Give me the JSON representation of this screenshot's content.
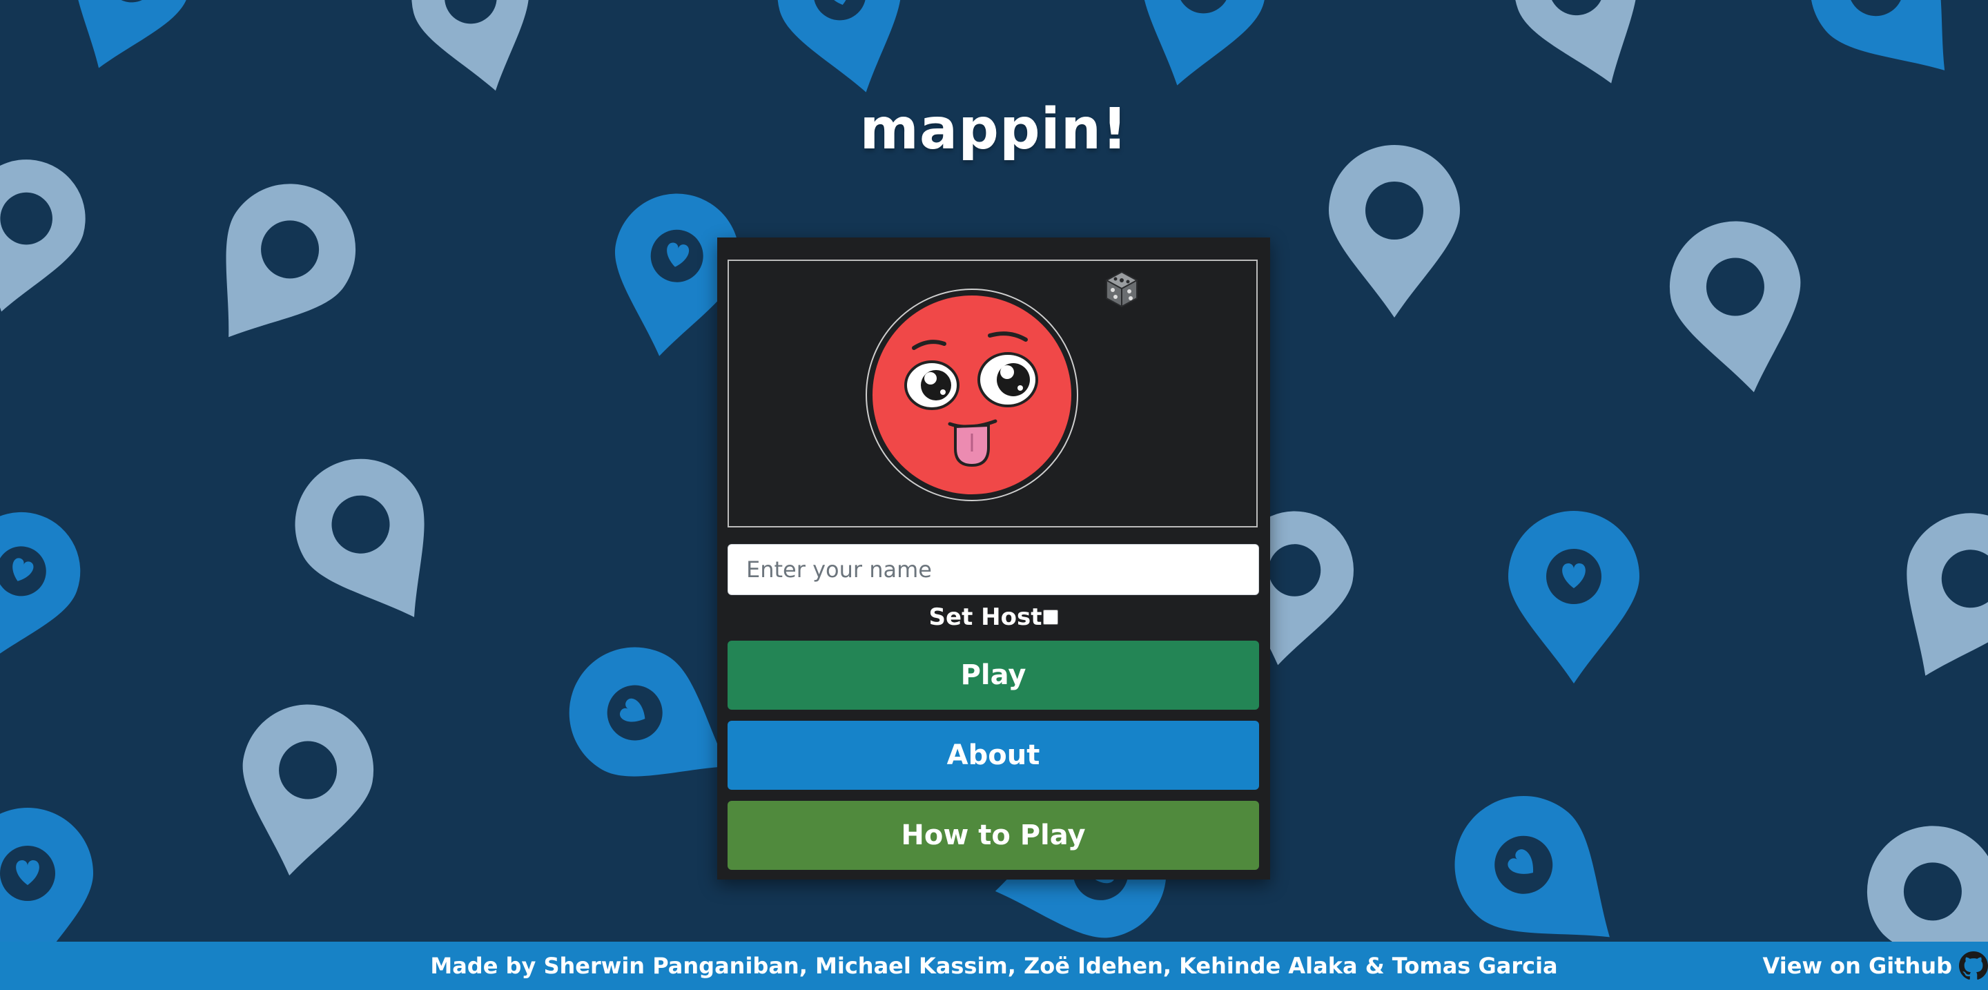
{
  "app": {
    "title": "mappin!"
  },
  "avatar": {
    "dice_icon": "dice-icon",
    "face_color": "#f04848"
  },
  "form": {
    "name_placeholder": "Enter your name",
    "name_value": "",
    "host_label": "Set Host",
    "host_checked": false
  },
  "buttons": {
    "play": "Play",
    "about": "About",
    "how_to_play": "How to Play"
  },
  "footer": {
    "credits": "Made by Sherwin Panganiban, Michael Kassim, Zoë Idehen, Kehinde Alaka & Tomas Garcia",
    "github_label": "View on Github",
    "github_icon": "github-icon"
  },
  "colors": {
    "background": "#133553",
    "pin_light": "#8fb0cc",
    "pin_blue": "#1a80c8",
    "play": "#238555",
    "about": "#1683c9",
    "how_to_play": "#508a3d",
    "footer": "#1782c6"
  }
}
